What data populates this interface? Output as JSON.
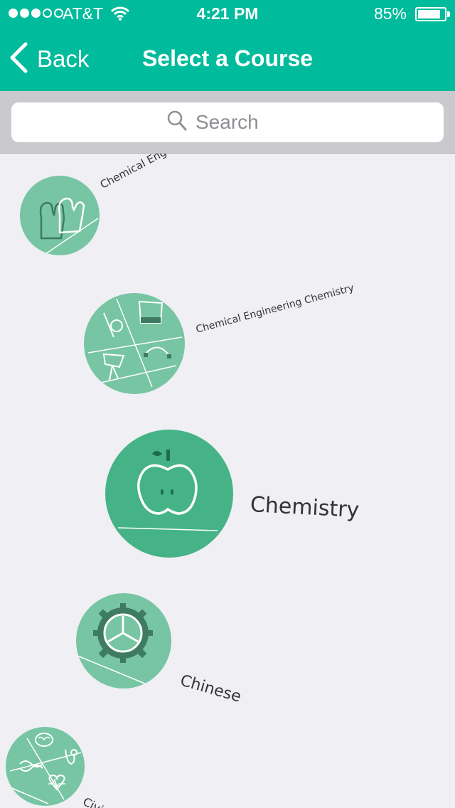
{
  "status_bar": {
    "carrier": "AT&T",
    "time": "4:21 PM",
    "battery_percent": "85%",
    "battery_level": 0.85,
    "signal_bars_filled": 3,
    "signal_bars_total": 5
  },
  "nav": {
    "back_label": "Back",
    "title": "Select a Course"
  },
  "search": {
    "placeholder": "Search"
  },
  "courses": [
    {
      "label": "Chemical Eng",
      "icon": "mittens-icon"
    },
    {
      "label": "Chemical Engineering Chemistry",
      "icon": "design-tools-icon"
    },
    {
      "label": "Chemistry",
      "icon": "apple-icon"
    },
    {
      "label": "Chinese",
      "icon": "gear-icon"
    },
    {
      "label": "Civi",
      "icon": "medical-science-icon"
    }
  ],
  "colors": {
    "header": "#00bb9c",
    "circle": "#77c5a3",
    "circle_selected": "#45b386",
    "background": "#efeff4"
  }
}
